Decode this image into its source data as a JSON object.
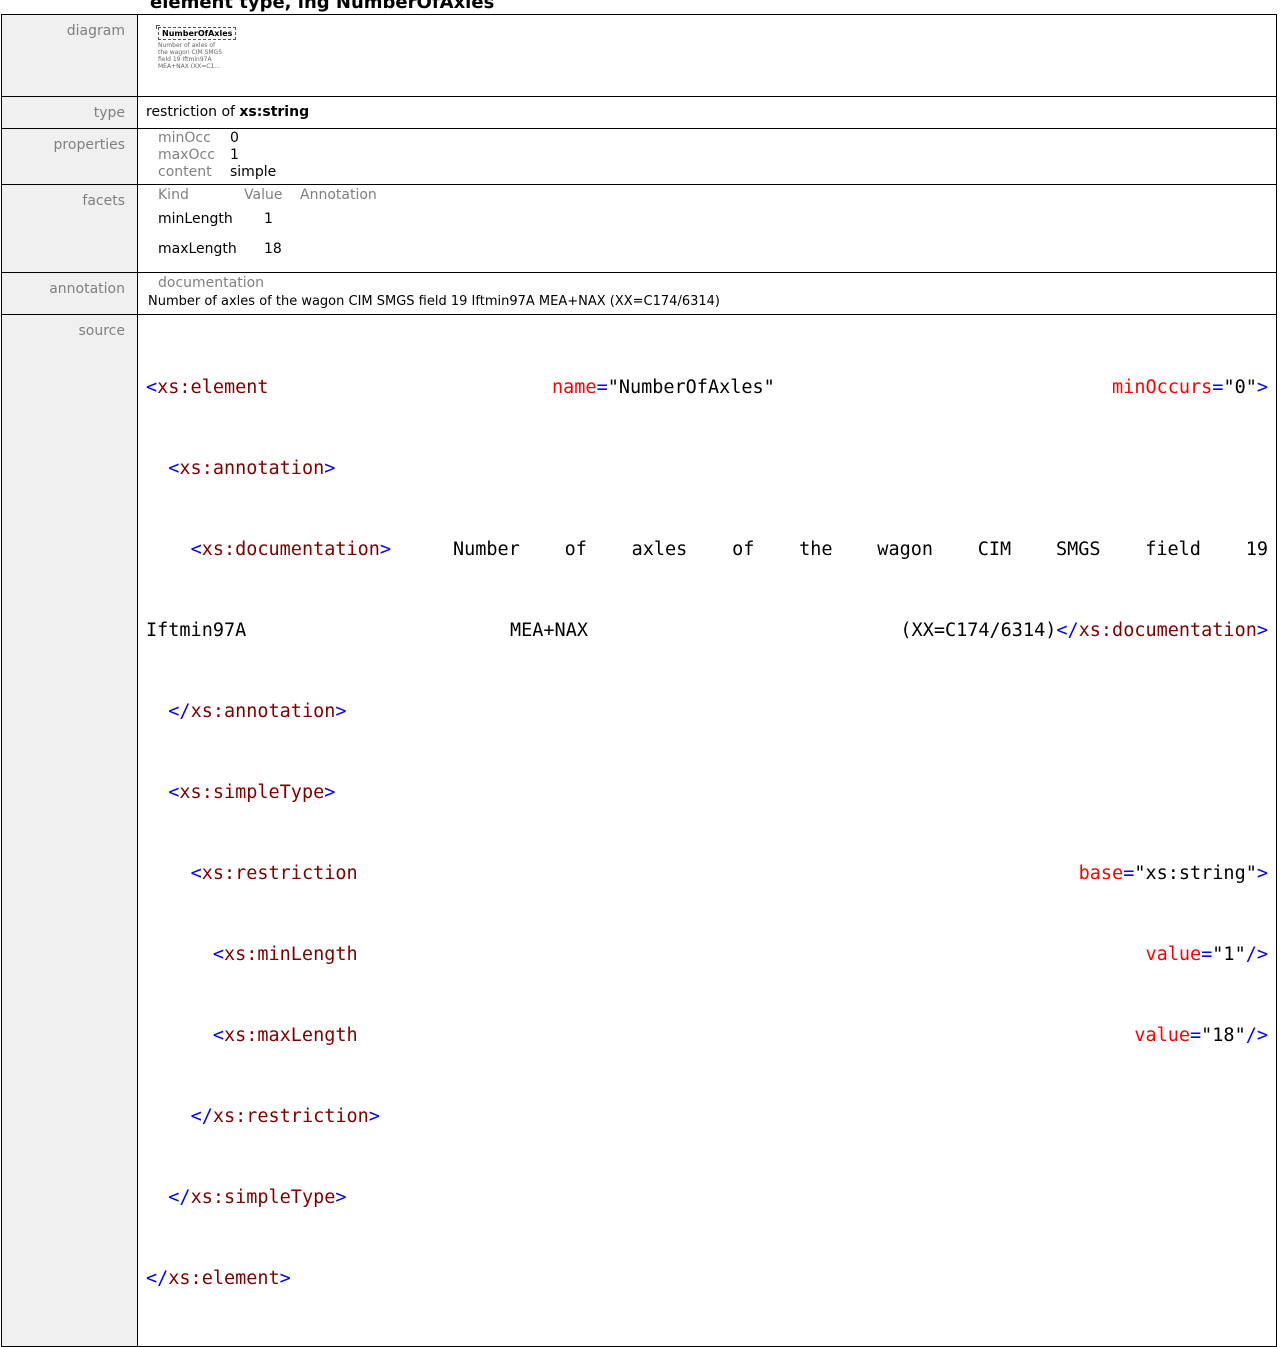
{
  "heading": "element type, ing NumberOfAxles",
  "labels": {
    "diagram": "diagram",
    "type": "type",
    "properties": "properties",
    "facets": "facets",
    "annotation": "annotation",
    "source": "source"
  },
  "diagram": {
    "box_label": "NumberOfAxles",
    "note": "Number of axles of the wagon CIM SMGS field 19 Iftmin97A MEA+NAX (XX=C1..."
  },
  "type": {
    "prefix": "restriction of",
    "base": "xs:string"
  },
  "properties": [
    {
      "key": "minOcc",
      "value": "0"
    },
    {
      "key": "maxOcc",
      "value": "1"
    },
    {
      "key": "content",
      "value": "simple"
    }
  ],
  "facets": {
    "headers": [
      "Kind",
      "Value",
      "Annotation"
    ],
    "rows": [
      {
        "kind": "minLength",
        "value": "1"
      },
      {
        "kind": "maxLength",
        "value": "18"
      }
    ]
  },
  "annotation": {
    "key": "documentation",
    "text": "Number of axles of the wagon CIM SMGS field 19 Iftmin97A MEA+NAX (XX=C174/6314)"
  },
  "source": {
    "l1_tag": "<xs:element",
    "l1_attr1": "name",
    "l1_val1": "\"NumberOfAxles\"",
    "l1_attr2": "minOccurs",
    "l1_val2": "\"0\"",
    "l2": "<xs:annotation>",
    "l3_tag": "<xs:documentation>",
    "l3_text": "Number of axles of the wagon CIM SMGS field 19",
    "l4_a": "Iftmin97A",
    "l4_b": "MEA+NAX",
    "l4_c": "(XX=C174/6314)",
    "l4_close": "</xs:documentation>",
    "l5": "</xs:annotation>",
    "l6": "<xs:simpleType>",
    "l7_tag": "<xs:restriction",
    "l7_attr": "base",
    "l7_val": "\"xs:string\"",
    "l8_tag": "<xs:minLength",
    "l8_attr": "value",
    "l8_val": "\"1\"",
    "l9_tag": "<xs:maxLength",
    "l9_attr": "value",
    "l9_val": "\"18\"",
    "l10": "</xs:restriction>",
    "l11": "</xs:simpleType>",
    "l12": "</xs:element>"
  }
}
